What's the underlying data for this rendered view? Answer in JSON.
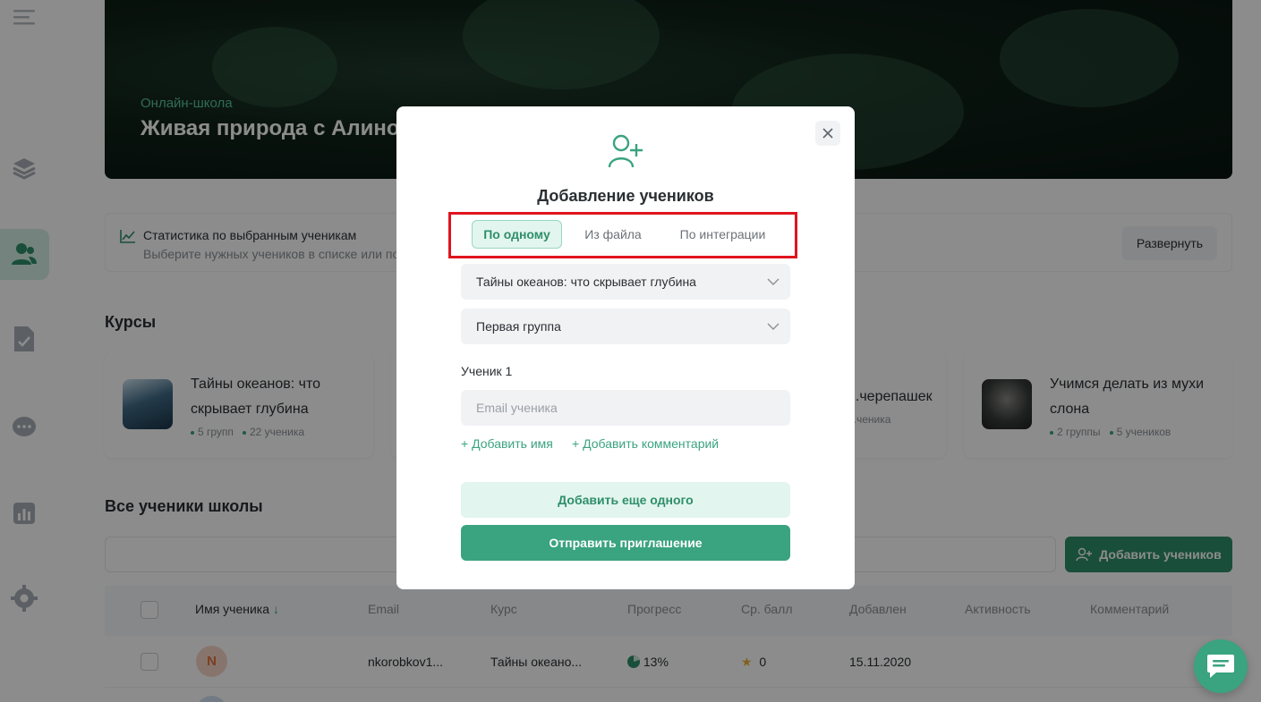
{
  "hero": {
    "subtitle": "Онлайн-школа",
    "title": "Живая природа с Алиной"
  },
  "stats": {
    "title": "Статистика по выбранным ученикам",
    "description": "Выберите нужных учеников в списке или по",
    "expand_label": "Развернуть"
  },
  "courses": {
    "heading": "Курсы",
    "items": [
      {
        "name": "Тайны океанов: что скрывает глубина",
        "groups": "5 групп",
        "students": "22 ученика"
      },
      {
        "name": "...черепашек",
        "groups": "",
        "students": "...ченика"
      },
      {
        "name": "Учимся делать из мухи слона",
        "groups": "2 группы",
        "students": "5 учеников"
      }
    ]
  },
  "students": {
    "heading": "Все ученики школы",
    "add_button": "Добавить учеников",
    "columns": [
      "Имя ученика",
      "Email",
      "Курс",
      "Прогресс",
      "Ср. балл",
      "Добавлен",
      "Активность",
      "Комментарий"
    ],
    "rows": [
      {
        "initial": "N",
        "email": "nkorobkov1...",
        "course": "Тайны океано...",
        "progress": "13%",
        "score": "0",
        "added": "15.11.2020"
      }
    ]
  },
  "modal": {
    "title": "Добавление учеников",
    "tabs": [
      "По одному",
      "Из файла",
      "По интеграции"
    ],
    "active_tab": "По одному",
    "course_select": "Тайны океанов: что скрывает глубина",
    "group_select": "Первая группа",
    "student_label": "Ученик 1",
    "email_placeholder": "Email ученика",
    "add_name_link": "+ Добавить имя",
    "add_comment_link": "+ Добавить комментарий",
    "add_another_button": "Добавить еще одного",
    "send_button": "Отправить приглашение"
  },
  "colors": {
    "accent": "#3aa37f",
    "highlight": "#e0141e"
  }
}
